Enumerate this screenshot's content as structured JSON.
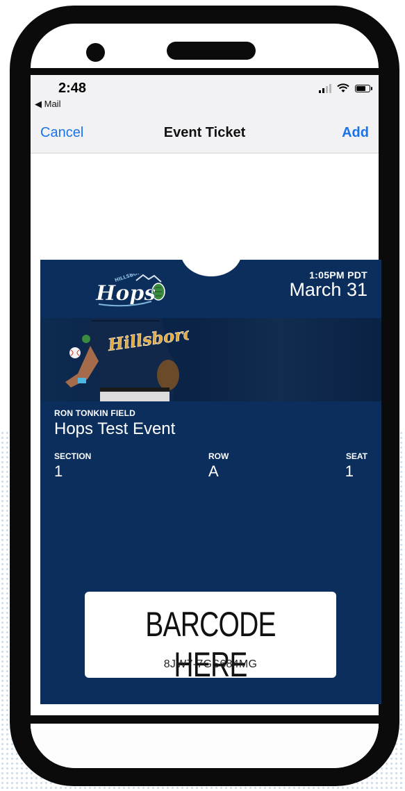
{
  "status_bar": {
    "time": "2:48",
    "back_label": "Mail"
  },
  "nav": {
    "cancel_label": "Cancel",
    "title": "Event Ticket",
    "add_label": "Add"
  },
  "ticket": {
    "logo_text": "Hops",
    "logo_subtext": "HILLSBORO",
    "event_time": "1:05PM PDT",
    "event_date": "March 31",
    "jersey_text": "Hillsboro",
    "venue": "RON TONKIN FIELD",
    "event_name": "Hops Test Event",
    "section_label": "SECTION",
    "section_value": "1",
    "row_label": "ROW",
    "row_value": "A",
    "seat_label": "SEAT",
    "seat_value": "1",
    "barcode_placeholder": "BARCODE HERE",
    "barcode_code": "8JW7-7GS684MG"
  },
  "colors": {
    "ticket_background": "#0b2e5c",
    "link_blue": "#1a73e8"
  },
  "icons": {
    "back": "back-arrow-icon",
    "signal": "cellular-signal-icon",
    "wifi": "wifi-icon",
    "battery": "battery-icon"
  }
}
